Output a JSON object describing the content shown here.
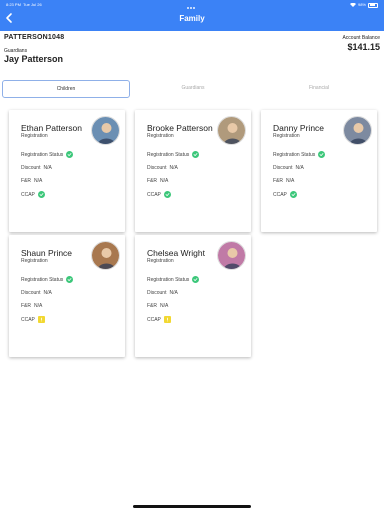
{
  "status_bar": {
    "time": "8:23 PM",
    "date": "Tue Jul 26",
    "battery": "98%"
  },
  "header": {
    "title": "Family"
  },
  "account": {
    "id": "PATTERSON1048",
    "balance_label": "Account Balance",
    "balance": "$141.15",
    "guardians_label": "Guardians",
    "guardian_name": "Jay Patterson"
  },
  "tabs": [
    {
      "label": "Children"
    },
    {
      "label": "Guardians"
    },
    {
      "label": "Financial"
    }
  ],
  "labels": {
    "registration": "Registration",
    "registration_status": "Registration Status",
    "discount": "Discount",
    "fr": "F&R",
    "ccap": "CCAP"
  },
  "children": [
    {
      "name": "Ethan Patterson",
      "discount": "N/A",
      "fr": "N/A",
      "ccap": "check",
      "avatar_color": "#6b8fb3"
    },
    {
      "name": "Brooke Patterson",
      "discount": "N/A",
      "fr": "N/A",
      "ccap": "check",
      "avatar_color": "#b09a7c"
    },
    {
      "name": "Danny Prince",
      "discount": "N/A",
      "fr": "N/A",
      "ccap": "check",
      "avatar_color": "#7d8aa0"
    },
    {
      "name": "Shaun Prince",
      "discount": "N/A",
      "fr": "N/A",
      "ccap": "warning",
      "avatar_color": "#a8784f"
    },
    {
      "name": "Chelsea Wright",
      "discount": "N/A",
      "fr": "N/A",
      "ccap": "warning",
      "avatar_color": "#c07aa6"
    }
  ]
}
